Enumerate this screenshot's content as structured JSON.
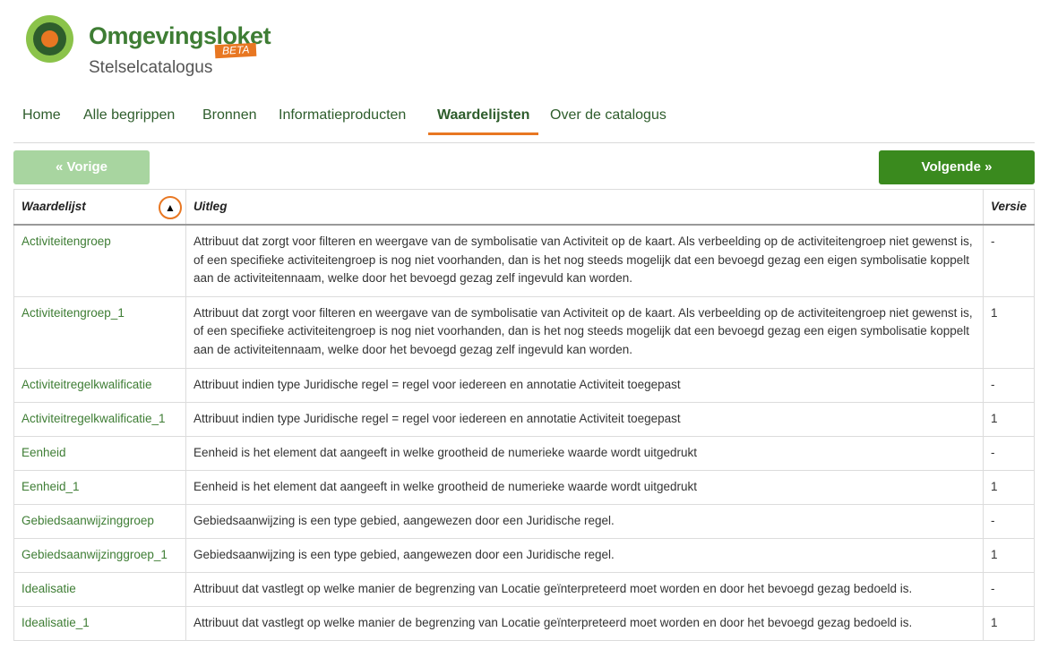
{
  "brand": {
    "name": "Omgevingsloket",
    "badge": "BETA",
    "subtitle": "Stelselcatalogus"
  },
  "nav": [
    {
      "label": "Home"
    },
    {
      "label": "Alle begrippen"
    },
    {
      "label": "Bronnen"
    },
    {
      "label": "Informatieproducten"
    },
    {
      "label": "Waardelijsten"
    },
    {
      "label": "Over de catalogus"
    }
  ],
  "pagination": {
    "prev": "« Vorige",
    "next": "Volgende »"
  },
  "table": {
    "headers": {
      "name": "Waardelijst",
      "explanation": "Uitleg",
      "version": "Versie",
      "sort": "▲"
    },
    "rows": [
      {
        "name": "Activiteitengroep",
        "explanation": "Attribuut dat zorgt voor filteren en weergave van de symbolisatie van Activiteit op de kaart. Als verbeelding op de activiteitengroep niet gewenst is, of een specifieke activiteitengroep is nog niet voorhanden, dan is het nog steeds mogelijk dat een bevoegd gezag een eigen symbolisatie koppelt aan de activiteitennaam, welke door het bevoegd gezag zelf ingevuld kan worden.",
        "version": "-"
      },
      {
        "name": "Activiteitengroep_1",
        "explanation": "Attribuut dat zorgt voor filteren en weergave van de symbolisatie van Activiteit op de kaart. Als verbeelding op de activiteitengroep niet gewenst is, of een specifieke activiteitengroep is nog niet voorhanden, dan is het nog steeds mogelijk dat een bevoegd gezag een eigen symbolisatie koppelt aan de activiteitennaam, welke door het bevoegd gezag zelf ingevuld kan worden.",
        "version": "1"
      },
      {
        "name": "Activiteitregelkwalificatie",
        "explanation": "Attribuut indien type Juridische regel = regel voor iedereen en annotatie Activiteit toegepast",
        "version": "-"
      },
      {
        "name": "Activiteitregelkwalificatie_1",
        "explanation": "Attribuut indien type Juridische regel = regel voor iedereen en annotatie Activiteit toegepast",
        "version": "1"
      },
      {
        "name": "Eenheid",
        "explanation": "Eenheid is het element dat aangeeft in welke grootheid de numerieke waarde wordt uitgedrukt",
        "version": "-"
      },
      {
        "name": "Eenheid_1",
        "explanation": "Eenheid is het element dat aangeeft in welke grootheid de numerieke waarde wordt uitgedrukt",
        "version": "1"
      },
      {
        "name": "Gebiedsaanwijzinggroep",
        "explanation": "Gebiedsaanwijzing is een type gebied, aangewezen door een Juridische regel.",
        "version": "-"
      },
      {
        "name": "Gebiedsaanwijzinggroep_1",
        "explanation": "Gebiedsaanwijzing is een type gebied, aangewezen door een Juridische regel.",
        "version": "1"
      },
      {
        "name": "Idealisatie",
        "explanation": "Attribuut dat vastlegt op welke manier de begrenzing van Locatie geïnterpreteerd moet worden en door het bevoegd gezag bedoeld is.",
        "version": "-"
      },
      {
        "name": "Idealisatie_1",
        "explanation": "Attribuut dat vastlegt op welke manier de begrenzing van Locatie geïnterpreteerd moet worden en door het bevoegd gezag bedoeld is.",
        "version": "1"
      }
    ]
  },
  "colors": {
    "accent": "#e87722",
    "brand_green": "#3e7d34",
    "button_green": "#3a8a1e",
    "button_disabled": "#a8d5a0"
  }
}
